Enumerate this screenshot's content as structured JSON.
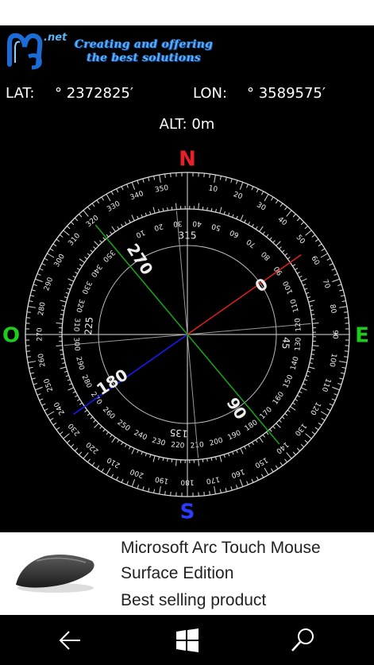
{
  "header": {
    "logo_net": ".net",
    "tagline_line1": "Creating and offering",
    "tagline_line2": "the best solutions"
  },
  "location": {
    "lat_label": "LAT:",
    "lat_value": "° 2372825′",
    "lon_label": "LON:",
    "lon_value": "° 3589575′",
    "alt_text": "ALT: 0m"
  },
  "compass": {
    "cardinals": {
      "north": "N",
      "east": "E",
      "south": "S",
      "west": "O"
    },
    "colors": {
      "north": "#e8202a",
      "south": "#2a3cff",
      "east": "#1ecc1e",
      "west": "#1ecc1e",
      "red_needle": "#e02020",
      "blue_needle": "#1a1aff",
      "green_needle": "#16a816"
    },
    "outer_labels_step": 10,
    "inner_labels_step": 10,
    "small_label_values": [
      315,
      45,
      135,
      225
    ],
    "large_label_values": [
      0,
      90,
      180,
      270
    ]
  },
  "ad": {
    "title": "Microsoft Arc Touch Mouse Surface Edition",
    "subtitle": "Best selling product"
  },
  "nav": {
    "back": "back-arrow",
    "home": "windows-logo",
    "search": "search"
  }
}
